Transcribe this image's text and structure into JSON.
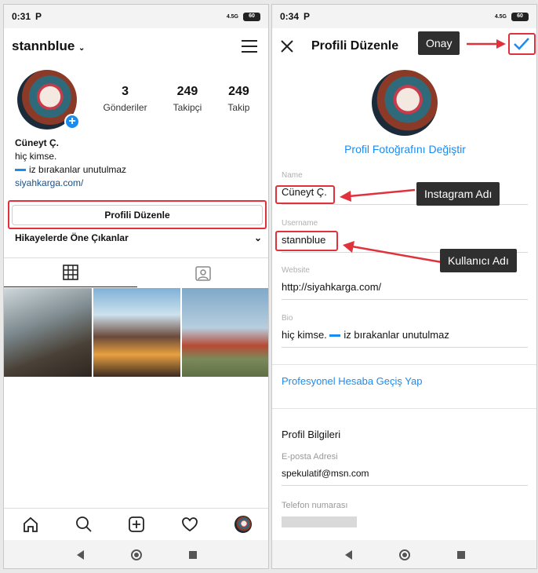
{
  "left": {
    "status": {
      "time": "0:31",
      "carrier": "P",
      "signal": "4.5G",
      "battery": "60"
    },
    "username": "stannblue",
    "stats": [
      {
        "value": "3",
        "label": "Gönderiler"
      },
      {
        "value": "249",
        "label": "Takipçi"
      },
      {
        "value": "249",
        "label": "Takip"
      }
    ],
    "bio": {
      "name": "Cüneyt Ç.",
      "line1": "hiç kimse.",
      "line2": "iz bırakanlar unutulmaz",
      "link": "siyahkarga.com/"
    },
    "edit_button": "Profili Düzenle",
    "highlights": "Hikayelerde Öne Çıkanlar"
  },
  "right": {
    "status": {
      "time": "0:34",
      "carrier": "P",
      "signal": "4.5G",
      "battery": "60"
    },
    "title": "Profili Düzenle",
    "change_photo": "Profil Fotoğrafını Değiştir",
    "fields": {
      "name": {
        "label": "Name",
        "value": "Cüneyt Ç."
      },
      "username": {
        "label": "Username",
        "value": "stannblue"
      },
      "website": {
        "label": "Website",
        "value": "http://siyahkarga.com/"
      },
      "bio": {
        "label": "Bio",
        "value_a": "hiç kimse.",
        "value_b": "iz bırakanlar unutulmaz"
      }
    },
    "pro_link": "Profesyonel Hesaba Geçiş Yap",
    "section_title": "Profil Bilgileri",
    "email": {
      "label": "E-posta Adresi",
      "value": "spekulatif@msn.com"
    },
    "phone": {
      "label": "Telefon numarası"
    }
  },
  "callouts": {
    "onay": "Onay",
    "instagram": "Instagram Adı",
    "kullanici": "Kullanıcı Adı"
  },
  "colors": {
    "accent": "#1a8cf0",
    "annotation_red": "#e0323c",
    "callout_bg": "#2f2f2f"
  }
}
